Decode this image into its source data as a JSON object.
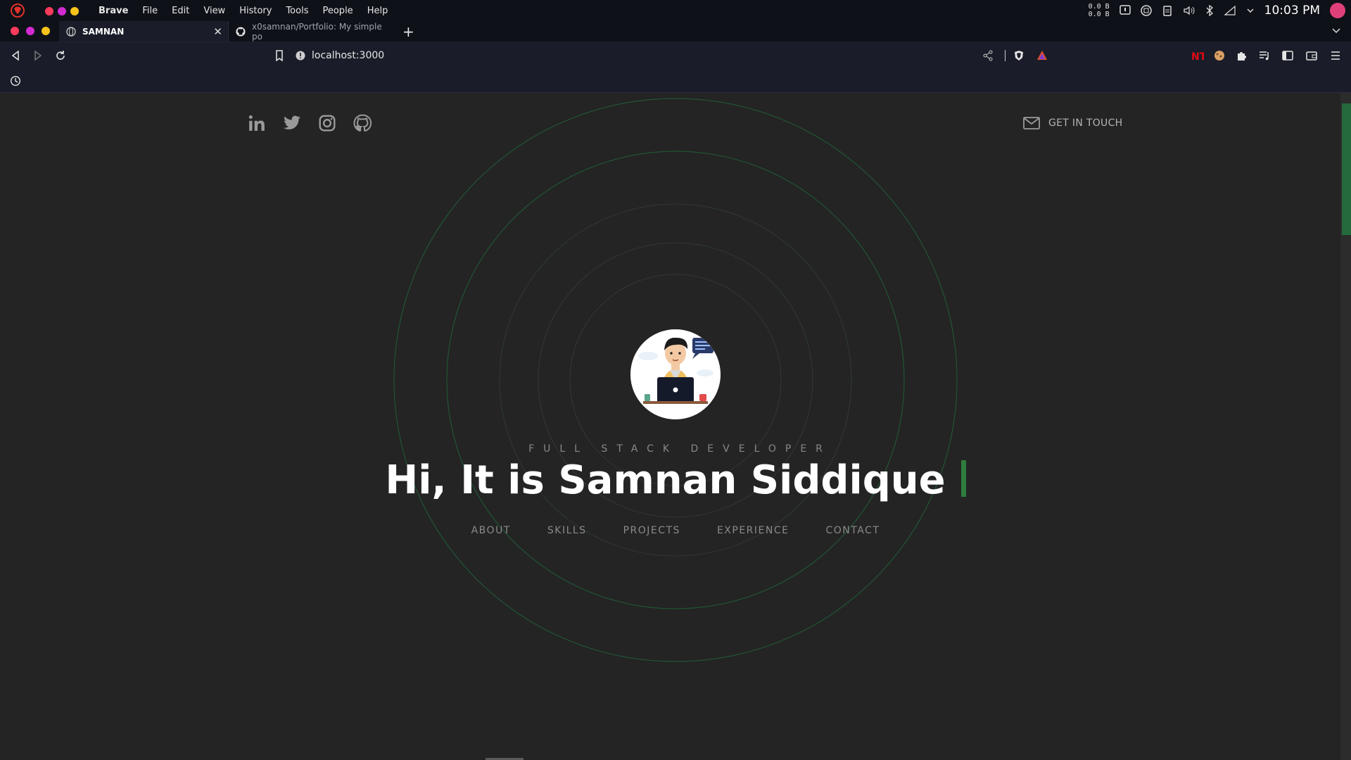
{
  "menubar": {
    "app_name": "Brave",
    "items": [
      "File",
      "Edit",
      "View",
      "History",
      "Tools",
      "People",
      "Help"
    ],
    "net_up": "0.0 B",
    "net_down": "0.0 B",
    "time": "10:03 PM",
    "traffic_colors": [
      "#ff3b5c",
      "#d22bd2",
      "#f6c31a"
    ]
  },
  "tabs": [
    {
      "title": "SAMNAN",
      "icon": "globe-icon",
      "active": true
    },
    {
      "title": "x0samnan/Portfolio: My simple po",
      "icon": "github-icon",
      "active": false
    }
  ],
  "toolbar": {
    "url": "localhost:3000"
  },
  "page": {
    "social_icons": [
      "linkedin-icon",
      "twitter-icon",
      "instagram-icon",
      "github-icon"
    ],
    "get_in_touch": "GET IN TOUCH",
    "subtitle": "FULL STACK DEVELOPER",
    "headline": "Hi, It is Samnan Siddique",
    "nav": [
      "ABOUT",
      "SKILLS",
      "PROJECTS",
      "EXPERIENCE",
      "CONTACT"
    ],
    "accent_color": "#2f7d3e",
    "background_color": "#242424"
  }
}
